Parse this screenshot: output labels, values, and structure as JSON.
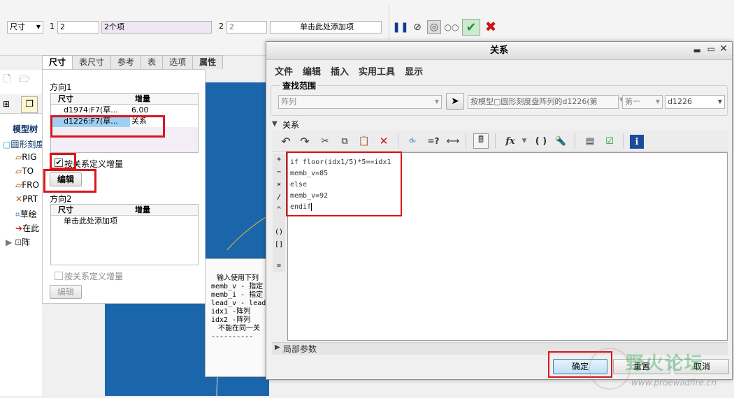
{
  "ribbon": {
    "field1_select": "尺寸",
    "field1_num_label": "1",
    "field1_value": "2",
    "field1_items": "2个项",
    "field2_num_label": "2",
    "field2_value": "2",
    "field2_add_placeholder": "单击此处添加项"
  },
  "tabs": [
    "尺寸",
    "表尺寸",
    "参考",
    "表",
    "选项",
    "属性"
  ],
  "panel": {
    "direction1_label": "方向1",
    "direction2_label": "方向2",
    "col_dim": "尺寸",
    "col_inc": "增量",
    "rows": [
      {
        "dim": "d1974:F7(草...",
        "inc": "6.00"
      },
      {
        "dim": "d1226:F7(草...",
        "inc": "关系"
      }
    ],
    "relation_check_label": "按关系定义增量",
    "edit_label": "编辑",
    "direction2_add": "单击此处添加项",
    "relation_check2_label": "按关系定义增量",
    "edit2_label": "编辑"
  },
  "model_tree": {
    "title": "模型树",
    "items": [
      "圆形刻度",
      "RIG",
      "TO",
      "FRO",
      "PRT",
      "草绘",
      "在此",
      "阵"
    ]
  },
  "background_note": {
    "lines": [
      "输入使用下列",
      "memb_v - 指定",
      "memb_i - 指定",
      "lead_v - lead",
      "idx1   -阵列",
      "idx2   -阵列",
      "不能在同一关"
    ]
  },
  "dialog": {
    "title": "关系",
    "menu": [
      "文件",
      "编辑",
      "插入",
      "实用工具",
      "显示"
    ],
    "scope_label": "查找范围",
    "scope_select": "阵列",
    "scope_model": "按模型▢圆形刻度盘阵列的d1226(第",
    "scope_first": "第一",
    "scope_dim": "d1226",
    "relations_label": "关系",
    "ops": [
      "+",
      "−",
      "×",
      "/",
      "^",
      "()",
      "[]",
      "="
    ],
    "code_lines": [
      "if floor(idx1/5)*5==idx1",
      "memb_v=85",
      "else",
      "memb_v=92",
      "endif"
    ],
    "local_params_label": "局部参数",
    "ok_label": "确定",
    "reset_label": "重置",
    "cancel_label": "取消"
  },
  "watermark": {
    "title": "野火论坛",
    "url": "www.proewildfire.cn"
  },
  "colors": {
    "highlight_red": "#d8161b",
    "cad_blue": "#1b66aa",
    "check_green": "#1a9c2e",
    "cancel_red": "#c8141a"
  }
}
